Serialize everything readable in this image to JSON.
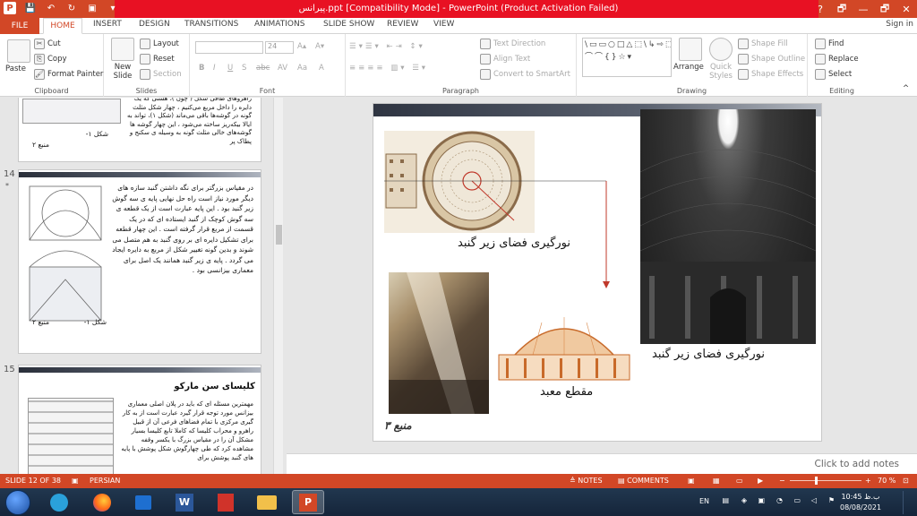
{
  "window": {
    "title": "پیرانس.ppt [Compatibility Mode] - PowerPoint (Product Activation Failed)",
    "controls": [
      "?",
      "🗗",
      "—",
      "🗗",
      "✕"
    ]
  },
  "tabs": [
    "FILE",
    "HOME",
    "INSERT",
    "DESIGN",
    "TRANSITIONS",
    "ANIMATIONS",
    "SLIDE SHOW",
    "REVIEW",
    "VIEW"
  ],
  "signin": "Sign in",
  "ribbon": {
    "clipboard": {
      "label": "Clipboard",
      "paste": "Paste",
      "cut": "Cut",
      "copy": "Copy",
      "format_painter": "Format Painter"
    },
    "slides": {
      "label": "Slides",
      "new_slide": "New Slide",
      "layout": "Layout",
      "reset": "Reset",
      "section": "Section"
    },
    "font": {
      "label": "Font",
      "size": "24",
      "bold": "B",
      "italic": "I",
      "underline": "U",
      "strike": "S",
      "abc": "abc",
      "av": "AV",
      "aa": "Aa",
      "fontcolor": "A"
    },
    "paragraph": {
      "label": "Paragraph",
      "text_direction": "Text Direction",
      "align_text": "Align Text",
      "convert": "Convert to SmartArt"
    },
    "drawing": {
      "label": "Drawing",
      "arrange": "Arrange",
      "quick_styles": "Quick Styles",
      "shape_fill": "Shape Fill",
      "shape_outline": "Shape Outline",
      "shape_effects": "Shape Effects",
      "gallery": "\\▭▭○□△⬚\\↳⇨⬚↱▭☆ ⌒⌒{}☆▾"
    },
    "editing": {
      "label": "Editing",
      "find": "Find",
      "replace": "Replace",
      "select": "Select"
    }
  },
  "thumbnails": {
    "partial_text": "راهروهای طاقی شکل ( چون )، هشتی که یک دایره را داخل مربع می‌کنیم ، چهار شکل مثلث گونه در گوشه‌ها باقی می‌ماند (شکل ۱)، تواند به ایالا بیکه‌ریز ساخته می‌شود ، این چهار گوشه ها گوشه‌های خالی مثلث گونه به وسیله ی سکنج و پطاک پر",
    "partial_fig_label": "شکل ۱-",
    "partial_ref": "منبع ۲",
    "slide14": {
      "num": "14",
      "text": "در مقیاس بزرگتر برای نگه داشتن گنبد سازه های دیگر مورد نیاز است راه حل نهایی پایه ی سه گوش زیر گنبد بود . این پایه عبارت است از یک قطعه ی سه گوش کوچک از گنبد ایستاده ای که در یک قسمت از مربع قرار گرفته است . این چهار قطعه برای تشکیل دایره ای بر روی گنبد به هم متصل می شوند و بدین گونه تغییر شکل از مربع به دایره ایجاد می گردد . پایه ی زیر گنبد همانند یک اصل برای معماری بیزانسی بود .",
      "fig_label": "شکل ۱-",
      "ref": "منبع ۲"
    },
    "slide15": {
      "num": "15",
      "title": "کلیسای سن مارکو",
      "text": "مهمترین مسئله ای که باید در پلان اصلی معماری بیزانس مورد توجه قرار گیرد عبارت است از به کار گیری مرکزی با تمام فضاهای فرعی آن از قبیل راهرو و محراب کلیسا که کاملا تابع کلیسا بسیار مشکل آن را در مقیاس بزرگ با یکسر وقفه مشاهده کرد که طی چهارگوش شکل پوشش با پایه های گنبد پوشش برای"
    }
  },
  "slide": {
    "caption_plan": "نورگیری فضای زیر گنبد",
    "caption_photo": "نورگیری فضای زیر گنبد",
    "caption_section": "مقطع معبد",
    "reference": "منبع ۳"
  },
  "notes": {
    "placeholder": "Click to add notes"
  },
  "status": {
    "slide": "SLIDE 12 OF 38",
    "language": "PERSIAN",
    "notes": "NOTES",
    "comments": "COMMENTS",
    "zoom": "70 %"
  },
  "taskbar": {
    "word": "W",
    "ppt": "P",
    "lang": "EN",
    "time": "10:45 ب.ظ",
    "date": "08/08/2021"
  },
  "colors": {
    "accent": "#d24726",
    "title_red": "#e81123",
    "taskbar": "#1b2d44"
  }
}
